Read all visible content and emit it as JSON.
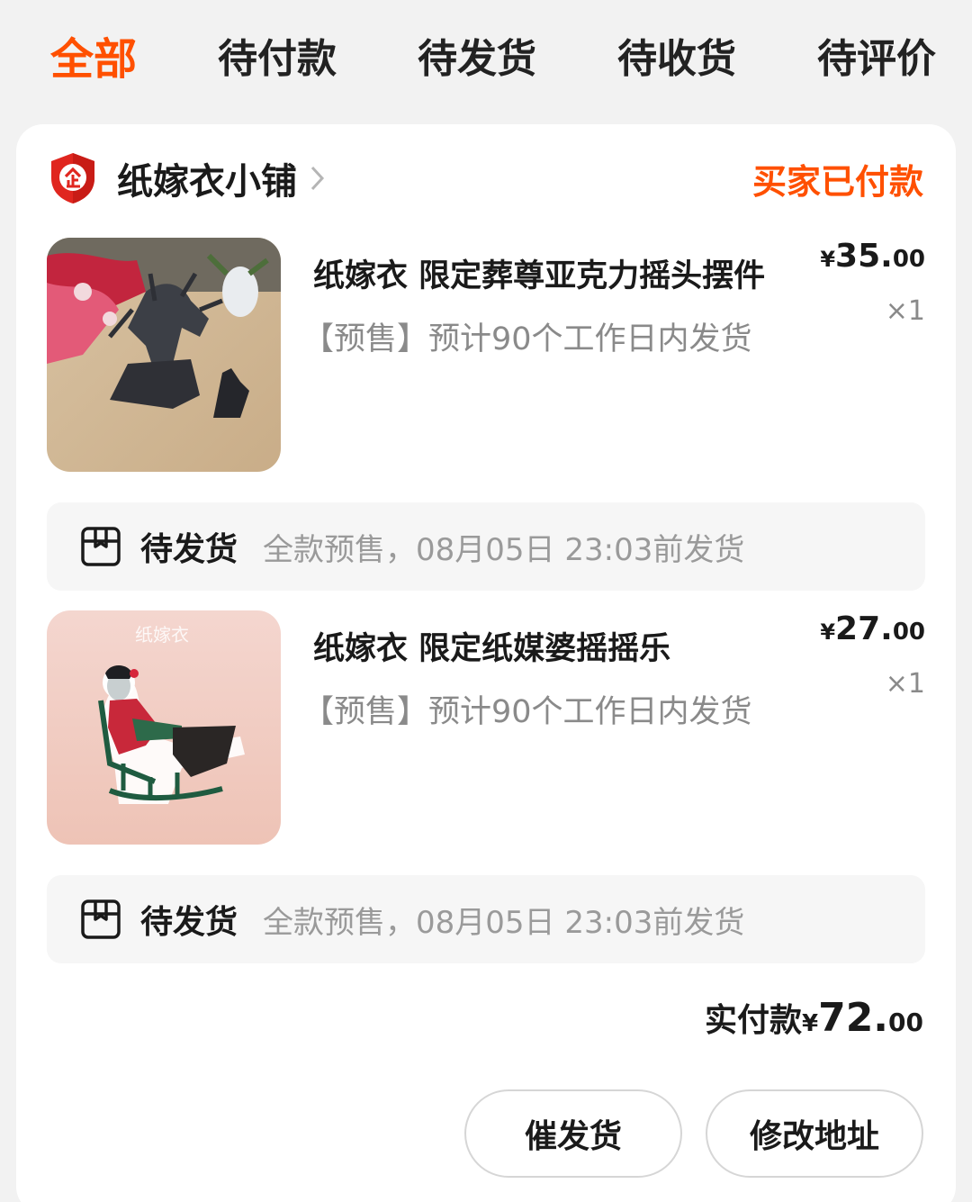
{
  "tabs": [
    {
      "label": "全部",
      "active": true
    },
    {
      "label": "待付款",
      "active": false
    },
    {
      "label": "待发货",
      "active": false
    },
    {
      "label": "待收货",
      "active": false
    },
    {
      "label": "待评价",
      "active": false
    }
  ],
  "order": {
    "shop_icon": "enterprise-shield-icon",
    "shop_name": "纸嫁衣小铺",
    "status": "买家已付款",
    "items": [
      {
        "title": "纸嫁衣 限定葬尊亚克力摇头摆件",
        "subtitle": "【预售】预计90个工作日内发货",
        "price_currency": "¥",
        "price_int": "35.",
        "price_dec": "00",
        "quantity": "×1",
        "ship_status": "待发货",
        "ship_info": "全款预售，08月05日 23:03前发货"
      },
      {
        "title": "纸嫁衣 限定纸媒婆摇摇乐",
        "subtitle": "【预售】预计90个工作日内发货",
        "price_currency": "¥",
        "price_int": "27.",
        "price_dec": "00",
        "quantity": "×1",
        "ship_status": "待发货",
        "ship_info": "全款预售，08月05日 23:03前发货",
        "image_text": "纸嫁衣"
      }
    ],
    "total_label": "实付款",
    "total_currency": "¥",
    "total_int": "72.",
    "total_dec": "00",
    "actions": {
      "urge": "催发货",
      "change_address": "修改地址"
    }
  },
  "colors": {
    "accent": "#ff5000",
    "background": "#f2f2f2",
    "card": "#ffffff",
    "muted_text": "#8a8a8a"
  }
}
